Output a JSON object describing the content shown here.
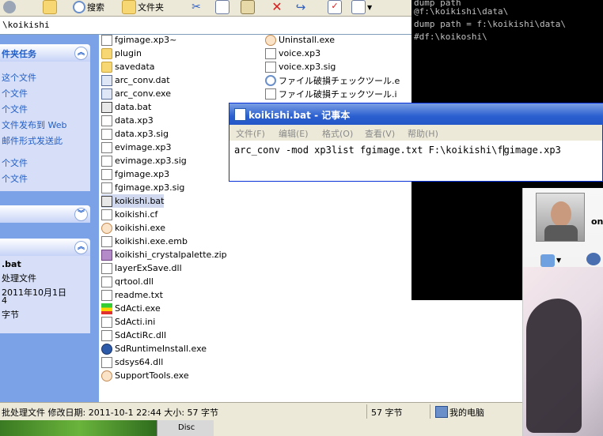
{
  "toolbar": {
    "search_label": "搜索",
    "folders_label": "文件夹"
  },
  "address": {
    "path": "\\koikishi"
  },
  "taskpane": {
    "folder_tasks_title": "件夹任务",
    "folder_tasks": [
      "这个文件",
      "个文件",
      "个文件",
      "文件发布到 Web",
      "邮件形式发送此",
      "个文件",
      "个文件"
    ],
    "details": {
      "name": ".bat",
      "type": "处理文件",
      "date": "2011年10月1日",
      "time": "4",
      "size": "字节"
    }
  },
  "files_col1": [
    {
      "name": "fgimage.xp3~",
      "icon": "doc"
    },
    {
      "name": "plugin",
      "icon": "folder"
    },
    {
      "name": "savedata",
      "icon": "folder"
    },
    {
      "name": "arc_conv.dat",
      "icon": "exe"
    },
    {
      "name": "arc_conv.exe",
      "icon": "exe"
    },
    {
      "name": "data.bat",
      "icon": "bat"
    },
    {
      "name": "data.xp3",
      "icon": "doc"
    },
    {
      "name": "data.xp3.sig",
      "icon": "doc"
    },
    {
      "name": "evimage.xp3",
      "icon": "doc"
    },
    {
      "name": "evimage.xp3.sig",
      "icon": "doc"
    },
    {
      "name": "fgimage.xp3",
      "icon": "doc"
    },
    {
      "name": "fgimage.xp3.sig",
      "icon": "doc"
    },
    {
      "name": "koikishi.bat",
      "icon": "bat"
    },
    {
      "name": "koikishi.cf",
      "icon": "doc"
    },
    {
      "name": "koikishi.exe",
      "icon": "char"
    },
    {
      "name": "koikishi.exe.emb",
      "icon": "doc"
    },
    {
      "name": "koikishi_crystalpalette.zip",
      "icon": "zip"
    },
    {
      "name": "layerExSave.dll",
      "icon": "doc"
    },
    {
      "name": "qrtool.dll",
      "icon": "doc"
    },
    {
      "name": "readme.txt",
      "icon": "doc"
    },
    {
      "name": "SdActi.exe",
      "icon": "bar"
    },
    {
      "name": "SdActi.ini",
      "icon": "doc"
    },
    {
      "name": "SdActiRc.dll",
      "icon": "doc"
    },
    {
      "name": "SdRuntimeInstall.exe",
      "icon": "setup"
    },
    {
      "name": "sdsys64.dll",
      "icon": "doc"
    },
    {
      "name": "SupportTools.exe",
      "icon": "char"
    }
  ],
  "files_col2": [
    {
      "name": "Uninstall.exe",
      "icon": "char"
    },
    {
      "name": "voice.xp3",
      "icon": "doc"
    },
    {
      "name": "voice.xp3.sig",
      "icon": "doc"
    },
    {
      "name": "ファイル破損チェックツール.e",
      "icon": "mag"
    },
    {
      "name": "ファイル破損チェックツール.i",
      "icon": "doc"
    }
  ],
  "statusbar": {
    "info": "批处理文件 修改日期: 2011-10-1 22:44 大小: 57 字节",
    "size": "57 字节",
    "location": "我的电脑"
  },
  "console": {
    "lines": [
      "@f:\\koikishi\\data\\",
      "dump path = f:\\koikishi\\data\\",
      "#df:\\koikoshi\\"
    ]
  },
  "notepad": {
    "title": "koikishi.bat - 记事本",
    "menu": [
      "文件(F)",
      "编辑(E)",
      "格式(O)",
      "查看(V)",
      "帮助(H)"
    ],
    "text_before_caret": "arc_conv -mod xp3list fgimage.txt F:\\koikishi\\f",
    "text_after_caret": "gimage.xp3"
  },
  "qq": {
    "name": "on"
  },
  "taskbar": {
    "disc_label": "Disc"
  }
}
